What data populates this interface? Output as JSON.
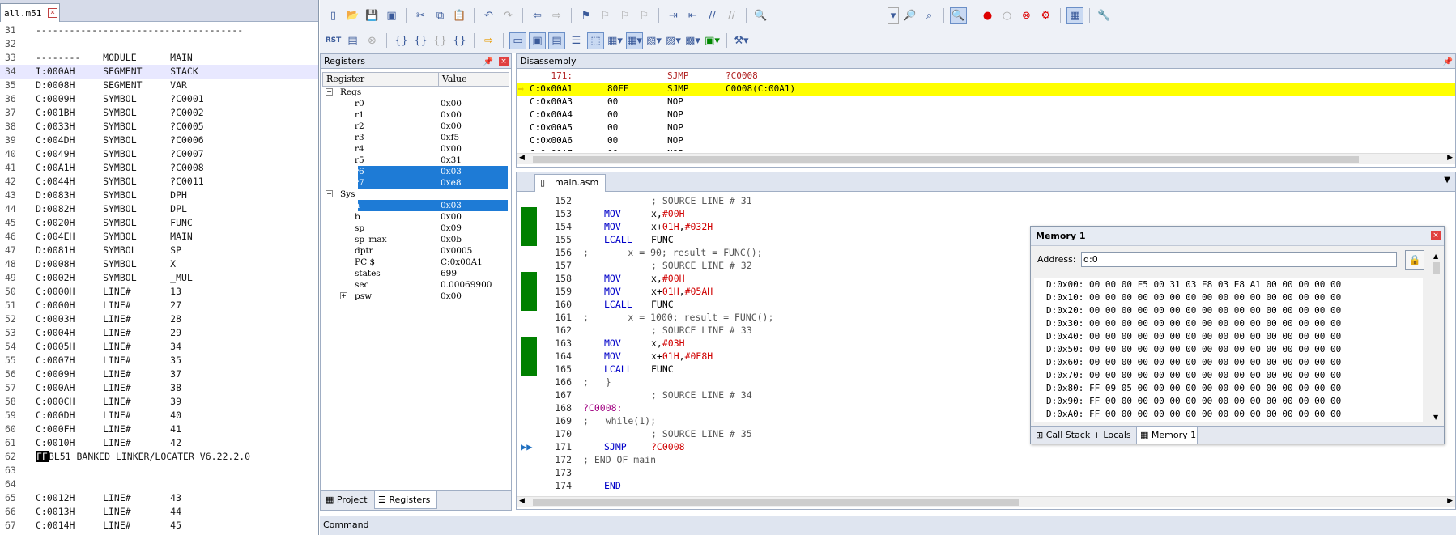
{
  "left_editor": {
    "tab_label": "all.m51",
    "lines": [
      {
        "n": "31",
        "t": "-------------------------------------",
        "hl": false
      },
      {
        "n": "32",
        "t": "",
        "hl": false
      },
      {
        "n": "33",
        "t": "--------    MODULE      MAIN",
        "hl": false
      },
      {
        "n": "34",
        "t": "I:000AH     SEGMENT     STACK",
        "hl": true
      },
      {
        "n": "35",
        "t": "D:0008H     SEGMENT     VAR",
        "hl": false
      },
      {
        "n": "36",
        "t": "C:0009H     SYMBOL      ?C0001",
        "hl": false
      },
      {
        "n": "37",
        "t": "C:001BH     SYMBOL      ?C0002",
        "hl": false
      },
      {
        "n": "38",
        "t": "C:0033H     SYMBOL      ?C0005",
        "hl": false
      },
      {
        "n": "39",
        "t": "C:004DH     SYMBOL      ?C0006",
        "hl": false
      },
      {
        "n": "40",
        "t": "C:0049H     SYMBOL      ?C0007",
        "hl": false
      },
      {
        "n": "41",
        "t": "C:00A1H     SYMBOL      ?C0008",
        "hl": false
      },
      {
        "n": "42",
        "t": "C:0044H     SYMBOL      ?C0011",
        "hl": false
      },
      {
        "n": "43",
        "t": "D:0083H     SYMBOL      DPH",
        "hl": false
      },
      {
        "n": "44",
        "t": "D:0082H     SYMBOL      DPL",
        "hl": false
      },
      {
        "n": "45",
        "t": "C:0020H     SYMBOL      FUNC",
        "hl": false
      },
      {
        "n": "46",
        "t": "C:004EH     SYMBOL      MAIN",
        "hl": false
      },
      {
        "n": "47",
        "t": "D:0081H     SYMBOL      SP",
        "hl": false
      },
      {
        "n": "48",
        "t": "D:0008H     SYMBOL      X",
        "hl": false
      },
      {
        "n": "49",
        "t": "C:0002H     SYMBOL      _MUL",
        "hl": false
      },
      {
        "n": "50",
        "t": "C:0000H     LINE#       13",
        "hl": false
      },
      {
        "n": "51",
        "t": "C:0000H     LINE#       27",
        "hl": false
      },
      {
        "n": "52",
        "t": "C:0003H     LINE#       28",
        "hl": false
      },
      {
        "n": "53",
        "t": "C:0004H     LINE#       29",
        "hl": false
      },
      {
        "n": "54",
        "t": "C:0005H     LINE#       34",
        "hl": false
      },
      {
        "n": "55",
        "t": "C:0007H     LINE#       35",
        "hl": false
      },
      {
        "n": "56",
        "t": "C:0009H     LINE#       37",
        "hl": false
      },
      {
        "n": "57",
        "t": "C:000AH     LINE#       38",
        "hl": false
      },
      {
        "n": "58",
        "t": "C:000CH     LINE#       39",
        "hl": false
      },
      {
        "n": "59",
        "t": "C:000DH     LINE#       40",
        "hl": false
      },
      {
        "n": "60",
        "t": "C:000FH     LINE#       41",
        "hl": false
      },
      {
        "n": "61",
        "t": "C:0010H     LINE#       42",
        "hl": false
      },
      {
        "n": "62",
        "t": "BL51 BANKED LINKER/LOCATER V6.22.2.0",
        "hl": false,
        "ff": "FF"
      },
      {
        "n": "63",
        "t": "",
        "hl": false
      },
      {
        "n": "64",
        "t": "",
        "hl": false
      },
      {
        "n": "65",
        "t": "C:0012H     LINE#       43",
        "hl": false
      },
      {
        "n": "66",
        "t": "C:0013H     LINE#       44",
        "hl": false
      },
      {
        "n": "67",
        "t": "C:0014H     LINE#       45",
        "hl": false
      }
    ]
  },
  "registers_panel": {
    "title": "Registers",
    "col_register": "Register",
    "col_value": "Value",
    "groups": [
      {
        "name": "Regs",
        "items": [
          {
            "n": "r0",
            "v": "0x00",
            "sel": false
          },
          {
            "n": "r1",
            "v": "0x00",
            "sel": false
          },
          {
            "n": "r2",
            "v": "0x00",
            "sel": false
          },
          {
            "n": "r3",
            "v": "0xf5",
            "sel": false
          },
          {
            "n": "r4",
            "v": "0x00",
            "sel": false
          },
          {
            "n": "r5",
            "v": "0x31",
            "sel": false
          },
          {
            "n": "r6",
            "v": "0x03",
            "sel": true
          },
          {
            "n": "r7",
            "v": "0xe8",
            "sel": true
          }
        ]
      },
      {
        "name": "Sys",
        "items": [
          {
            "n": "a",
            "v": "0x03",
            "sel": true
          },
          {
            "n": "b",
            "v": "0x00",
            "sel": false
          },
          {
            "n": "sp",
            "v": "0x09",
            "sel": false
          },
          {
            "n": "sp_max",
            "v": "0x0b",
            "sel": false
          },
          {
            "n": "dptr",
            "v": "0x0005",
            "sel": false
          },
          {
            "n": "PC  $",
            "v": "C:0x00A1",
            "sel": false
          },
          {
            "n": "states",
            "v": "699",
            "sel": false
          },
          {
            "n": "sec",
            "v": "0.00069900",
            "sel": false
          },
          {
            "n": "psw",
            "v": "0x00",
            "sel": false,
            "exp": true
          }
        ]
      }
    ],
    "tabs": [
      "Project",
      "Registers"
    ]
  },
  "disassembly": {
    "title": "Disassembly",
    "lines": [
      {
        "a": "    171:",
        "op": "",
        "m": "SJMP",
        "arg": "?C0008",
        "src": true
      },
      {
        "a": "C:0x00A1",
        "op": "80FE",
        "m": "SJMP",
        "arg": "C0008(C:00A1)",
        "cur": true
      },
      {
        "a": "C:0x00A3",
        "op": "00",
        "m": "NOP",
        "arg": ""
      },
      {
        "a": "C:0x00A4",
        "op": "00",
        "m": "NOP",
        "arg": ""
      },
      {
        "a": "C:0x00A5",
        "op": "00",
        "m": "NOP",
        "arg": ""
      },
      {
        "a": "C:0x00A6",
        "op": "00",
        "m": "NOP",
        "arg": ""
      },
      {
        "a": "C:0x00A7",
        "op": "00",
        "m": "NOP",
        "arg": ""
      }
    ]
  },
  "source": {
    "tab_label": "main.asm",
    "lines": [
      {
        "n": "152",
        "t": "; SOURCE LINE # 31",
        "k": "c2",
        "g": false
      },
      {
        "n": "153",
        "t": "MOV|x,#00H",
        "k": "ins",
        "g": true
      },
      {
        "n": "154",
        "t": "MOV|x+01H,#032H",
        "k": "ins",
        "g": true
      },
      {
        "n": "155",
        "t": "LCALL|FUNC",
        "k": "ins",
        "g": true
      },
      {
        "n": "156",
        "t": ";       x = 90; result = FUNC();",
        "k": "c1",
        "g": false
      },
      {
        "n": "157",
        "t": "; SOURCE LINE # 32",
        "k": "c2",
        "g": false
      },
      {
        "n": "158",
        "t": "MOV|x,#00H",
        "k": "ins",
        "g": true
      },
      {
        "n": "159",
        "t": "MOV|x+01H,#05AH",
        "k": "ins",
        "g": true
      },
      {
        "n": "160",
        "t": "LCALL|FUNC",
        "k": "ins",
        "g": true
      },
      {
        "n": "161",
        "t": ";       x = 1000; result = FUNC();",
        "k": "c1",
        "g": false
      },
      {
        "n": "162",
        "t": "; SOURCE LINE # 33",
        "k": "c2",
        "g": false
      },
      {
        "n": "163",
        "t": "MOV|x,#03H",
        "k": "ins",
        "g": true
      },
      {
        "n": "164",
        "t": "MOV|x+01H,#0E8H",
        "k": "ins",
        "g": true
      },
      {
        "n": "165",
        "t": "LCALL|FUNC",
        "k": "ins",
        "g": true
      },
      {
        "n": "166",
        "t": ";   }",
        "k": "c1",
        "g": false
      },
      {
        "n": "167",
        "t": "; SOURCE LINE # 34",
        "k": "c2",
        "g": false
      },
      {
        "n": "168",
        "t": "?C0008:",
        "k": "lbl",
        "g": false
      },
      {
        "n": "169",
        "t": ";   while(1);",
        "k": "c1",
        "g": false
      },
      {
        "n": "170",
        "t": "; SOURCE LINE # 35",
        "k": "c2",
        "g": false
      },
      {
        "n": "171",
        "t": "SJMP|?C0008",
        "k": "ins",
        "g": false,
        "cur": true
      },
      {
        "n": "172",
        "t": "; END OF main",
        "k": "c1",
        "g": false
      },
      {
        "n": "173",
        "t": "",
        "k": "c1",
        "g": false
      },
      {
        "n": "174",
        "t": "END",
        "k": "end",
        "g": false
      }
    ]
  },
  "memory": {
    "title": "Memory 1",
    "address_label": "Address:",
    "address_value": "d:0",
    "rows": [
      "D:0x00: 00 00 00 F5 00 31 03 E8 03 E8 A1 00 00 00 00 00",
      "D:0x10: 00 00 00 00 00 00 00 00 00 00 00 00 00 00 00 00",
      "D:0x20: 00 00 00 00 00 00 00 00 00 00 00 00 00 00 00 00",
      "D:0x30: 00 00 00 00 00 00 00 00 00 00 00 00 00 00 00 00",
      "D:0x40: 00 00 00 00 00 00 00 00 00 00 00 00 00 00 00 00",
      "D:0x50: 00 00 00 00 00 00 00 00 00 00 00 00 00 00 00 00",
      "D:0x60: 00 00 00 00 00 00 00 00 00 00 00 00 00 00 00 00",
      "D:0x70: 00 00 00 00 00 00 00 00 00 00 00 00 00 00 00 00",
      "D:0x80: FF 09 05 00 00 00 00 00 00 00 00 00 00 00 00 00",
      "D:0x90: FF 00 00 00 00 00 00 00 00 00 00 00 00 00 00 00",
      "D:0xA0: FF 00 00 00 00 00 00 00 00 00 00 00 00 00 00 00"
    ],
    "tabs": [
      "Call Stack + Locals",
      "Memory 1"
    ]
  },
  "command": {
    "title": "Command"
  },
  "colors": {
    "accent": "#1e7bd6",
    "breakpoint_green": "#008000",
    "current_line": "#ffff00"
  }
}
